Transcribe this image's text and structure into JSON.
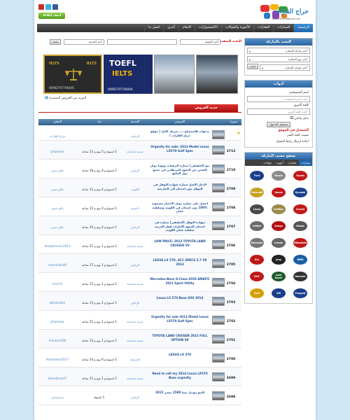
{
  "header": {
    "site_name": "حراج القارات",
    "site_url": "www.haraj-alqarat.com",
    "add_ad_button": "أضف إعلانك مجانا",
    "social_icons": [
      "youtube-icon",
      "twitter-icon",
      "facebook-icon"
    ]
  },
  "nav": {
    "items": [
      {
        "label": "الرئيسية",
        "active": true
      },
      {
        "label": "السيارات"
      },
      {
        "label": "العقارات"
      },
      {
        "label": "الأجهزة والجوالات"
      },
      {
        "label": "الاكسسوارات"
      },
      {
        "label": "الانعام"
      },
      {
        "label": "أخرى"
      },
      {
        "label": "اتصل بنا"
      }
    ]
  },
  "search": {
    "advanced_label": "البحث المتقدم",
    "city_placeholder": "أختر المدينة",
    "field_placeholder": "بحث",
    "category_placeholder": "أختر القسم"
  },
  "banners": {
    "ielts_text": "IELTS",
    "toefl_text": "TOEFL",
    "phone": "00962797746446",
    "card_caption": "TOEFL IELTS"
  },
  "special_offers_link": "المزيد من العروض المتميزة",
  "new_ads_title": "جديد العروض",
  "table": {
    "headers": {
      "image": "صورة",
      "title": "العروض",
      "category": "المدينة",
      "since": "منذ",
      "user": "المعلن"
    },
    "rows": [
      {
        "num": "",
        "title": "بدعوات للاستمتاع .... تعريف كامل ( موقع حراج القارات )",
        "cat": "الرياض",
        "since": "",
        "user": "حراج القارات",
        "featured": true
      },
      {
        "num": "2712",
        "title": "Urgently for sale: 2013 Model Lexus LX570 Gulf Spec",
        "cat": "مدينة متنازعة",
        "since": "1 اسبوع و 5 يوم و 12 ساعة",
        "user": "jahpreaw"
      },
      {
        "num": "2710",
        "title": "بيع (الحقيقي) سيارة الترقيات تويوتا دوبل الشحن عن المعهد البريطاني في جميع دول الخليج",
        "cat": "الرياض",
        "since": "1 اسبوع و 4 يوم و 18 ساعة",
        "user": "داليو حسن"
      },
      {
        "num": "2709",
        "title": "الدخل الاصل سيارة شهادة التوفل في التوفل دون امتحان إلى الخارجية",
        "cat": "الكويت",
        "since": "1 اسبوع و 4 يوم و 11 ساعة",
        "user": "داليو حسن"
      },
      {
        "num": "2708",
        "title": "احصل على سيارة دوبل الاختبار مضمونة %100 دون امتحان في الكويت وسلطنة عمان",
        "cat": "الدوحة",
        "since": "1 اسبوع و 4 يوم و 12 ساعة",
        "user": "داليو حسن"
      },
      {
        "num": "2707",
        "title": "شهادة التوفل (الحقيقي) سيارة في امتحان المعهد الامارات قطر العربية سلطنة عمان الكويت",
        "cat": "الرياض",
        "since": "1 اسبوع و 4 يوم و 10 ساعة",
        "user": "داليو حسن"
      },
      {
        "num": "2706",
        "title": "LOW PRICE: 2013 TOYOTA LAND CRUISER V8",
        "cat": "مدينة متنازعة",
        "since": "1 اسبوع و 1 يوم و 21 ساعة",
        "user": "ibowphoenix2013"
      },
      {
        "num": "2705",
        "title": "LEXUS LX 570, GCC SPECS 5.7 V8 2013",
        "cat": "الرياض",
        "since": "1 اسبوع و 1 يوم و 17 ساعة",
        "user": "marshalix46"
      },
      {
        "num": "2704",
        "title": "Mercedes-Benz G-Class 6550 AMATIC 2011 Sport Utility",
        "cat": "مدينة متنازعة",
        "since": "1 اسبوع و 1 يوم و 15 ساعة",
        "user": "miumi1"
      },
      {
        "num": "2703",
        "title": "Lexus LX 570 Base SUV 2014",
        "cat": "الرياض",
        "since": "1 اسبوع و 1 يوم و 13 ساعة",
        "user": "abnanafan"
      },
      {
        "num": "2702",
        "title": "Urgently for sale 2013 Model Lexus LX570 Gulf Spec",
        "cat": "مدينة متنازعة",
        "since": "1 اسبوع و 1 يوم و 21 ساعة",
        "user": "jahpreaw"
      },
      {
        "num": "2701",
        "title": "TOYOTA LAND CRUISER 2013 FULL OPTION V8",
        "cat": "مدينة متنازعة",
        "since": "1 اسبوع و 1 يوم و 12 ساعة",
        "user": "mbulser200"
      },
      {
        "num": "2700",
        "title": "LEXUS LX 570",
        "cat": "الشرقية",
        "since": "1 اسبوع و 6 يوم و 24 ساعة",
        "user": "Aderoduer2017"
      },
      {
        "num": "2699",
        "title": "Need to sell my 2014 Lexus LX570 Base urgently",
        "cat": "مدينة متنازعة",
        "since": "1 اسبوع و 1 يوم و 11 ساعة",
        "user": "ikieedmun47"
      },
      {
        "num": "2698",
        "title": "للبيع موديل جيتا 1500 بسعر 2015",
        "cat": "الرياض",
        "since": "1 اسبوع",
        "user": "مرسيداس"
      }
    ]
  },
  "sidebar": {
    "search_panel": {
      "title": "البحث بالماركة",
      "brand_select": "أختر ماركة السيارة",
      "type_select": "أختر نوع السيارة",
      "model_select": "أختر موديل السيارة",
      "search_button": "بحث"
    },
    "login_panel": {
      "title": "أدوات",
      "username_label": "اسم المستخدم",
      "username_placeholder": "اكتب اسم المستخدم",
      "password_label": "كلمة المرور",
      "password_placeholder": "اكتب كلمة المرور",
      "remember_label": "تذكر بياناتي",
      "login_button": "تسجيل الدخول",
      "register_link": "التسجيل في الموقع",
      "forgot_link": "نسيت كلمة السر",
      "activation_link": "اعادة ارسال رابط التفعيل"
    },
    "brands_panel": {
      "title": "تصفح حسب الماركة",
      "tabs": [
        "سيارات",
        "عقارات",
        "أجهزة",
        "جوالات"
      ],
      "brands": [
        {
          "name": "Ford",
          "color": "#1a3f8c"
        },
        {
          "name": "Nissan",
          "color": "#8a8a8a"
        },
        {
          "name": "Toyota",
          "color": "#c01818"
        },
        {
          "name": "Chevrolet",
          "color": "#c9a227"
        },
        {
          "name": "Honda",
          "color": "#c01818"
        },
        {
          "name": "Hyundai",
          "color": "#1a3f8c"
        },
        {
          "name": "Lexus",
          "color": "#4a4a4a"
        },
        {
          "name": "Cadillac",
          "color": "#9a8a4a"
        },
        {
          "name": "Suzuki",
          "color": "#c01818"
        },
        {
          "name": "Infiniti",
          "color": "#6a6a6a"
        },
        {
          "name": "Dodge",
          "color": "#b01010"
        },
        {
          "name": "Mazda",
          "color": "#555555"
        },
        {
          "name": "Mercedes",
          "color": "#777777"
        },
        {
          "name": "Lincoln",
          "color": "#666666"
        },
        {
          "name": "Mitsubishi",
          "color": "#c01818"
        },
        {
          "name": "Kia",
          "color": "#c01818"
        },
        {
          "name": "Jeep",
          "color": "#222222"
        },
        {
          "name": "BMW",
          "color": "#1a5fa8"
        },
        {
          "name": "GMC",
          "color": "#c01818"
        },
        {
          "name": "Land Rover",
          "color": "#1d5a2a"
        },
        {
          "name": "Hummer",
          "color": "#333333"
        },
        {
          "name": "Opel",
          "color": "#d4a000"
        },
        {
          "name": "VW",
          "color": "#1a3f8c"
        },
        {
          "name": "Peugeot",
          "color": "#1a3f8c"
        }
      ]
    }
  }
}
